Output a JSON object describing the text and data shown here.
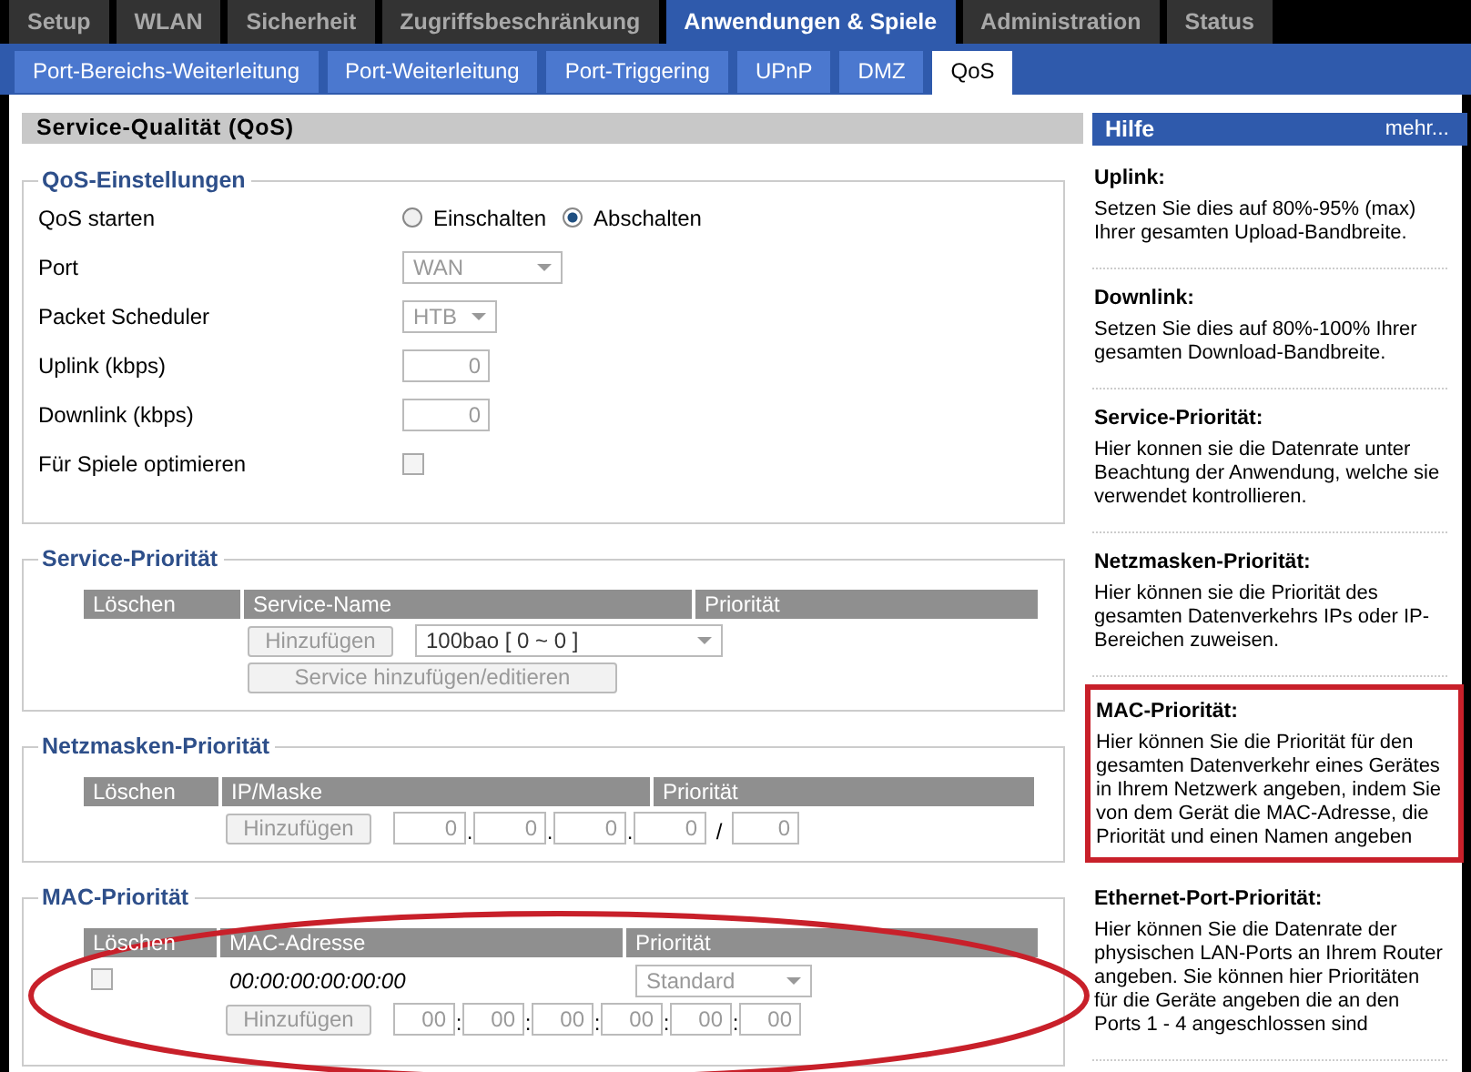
{
  "main_tabs": [
    {
      "label": "Setup",
      "selected": false
    },
    {
      "label": "WLAN",
      "selected": false
    },
    {
      "label": "Sicherheit",
      "selected": false
    },
    {
      "label": "Zugriffsbeschränkung",
      "selected": false
    },
    {
      "label": "Anwendungen & Spiele",
      "selected": true
    },
    {
      "label": "Administration",
      "selected": false
    },
    {
      "label": "Status",
      "selected": false
    }
  ],
  "sub_tabs": [
    {
      "label": "Port-Bereichs-Weiterleitung",
      "selected": false
    },
    {
      "label": "Port-Weiterleitung",
      "selected": false
    },
    {
      "label": "Port-Triggering",
      "selected": false
    },
    {
      "label": "UPnP",
      "selected": false
    },
    {
      "label": "DMZ",
      "selected": false
    },
    {
      "label": "QoS",
      "selected": true
    }
  ],
  "page_title": "Service-Qualität (QoS)",
  "qos_settings": {
    "legend": "QoS-Einstellungen",
    "rows": [
      {
        "kind": "radio",
        "label": "QoS starten",
        "options": [
          {
            "label": "Einschalten",
            "selected": false
          },
          {
            "label": "Abschalten",
            "selected": true
          }
        ]
      },
      {
        "kind": "select",
        "label": "Port",
        "value": "WAN"
      },
      {
        "kind": "select",
        "label": "Packet Scheduler",
        "value": "HTB"
      },
      {
        "kind": "number",
        "label": "Uplink (kbps)",
        "value": "0"
      },
      {
        "kind": "number",
        "label": "Downlink (kbps)",
        "value": "0"
      },
      {
        "kind": "checkbox",
        "label": "Für Spiele optimieren",
        "checked": false
      }
    ]
  },
  "service_priority": {
    "legend": "Service-Priorität",
    "columns": [
      "Löschen",
      "Service-Name",
      "Priorität"
    ],
    "add_button": "Hinzufügen",
    "service_select": "100bao [ 0 ~ 0 ]",
    "edit_button": "Service hinzufügen/editieren"
  },
  "netmask_priority": {
    "legend": "Netzmasken-Priorität",
    "columns": [
      "Löschen",
      "IP/Maske",
      "Priorität"
    ],
    "add_button": "Hinzufügen",
    "ip_fields": [
      "0",
      "0",
      "0",
      "0"
    ],
    "ip_separator": ".",
    "mask_separator": "/",
    "mask_field": "0"
  },
  "mac_priority": {
    "legend": "MAC-Priorität",
    "annotated": true,
    "columns": [
      "Löschen",
      "MAC-Adresse",
      "Priorität"
    ],
    "rows": [
      {
        "checked": false,
        "mac": "00:00:00:00:00:00",
        "priority": "Standard"
      }
    ],
    "add_button": "Hinzufügen",
    "mac_fields": [
      "00",
      "00",
      "00",
      "00",
      "00",
      "00"
    ],
    "mac_separator": ":"
  },
  "help": {
    "title": "Hilfe",
    "more": "mehr...",
    "items": [
      {
        "heading": "Uplink:",
        "text": "Setzen Sie dies auf 80%-95% (max) Ihrer gesamten Upload-Bandbreite.",
        "highlighted": false
      },
      {
        "heading": "Downlink:",
        "text": "Setzen Sie dies auf 80%-100% Ihrer gesamten Download-Bandbreite.",
        "highlighted": false
      },
      {
        "heading": "Service-Priorität:",
        "text": "Hier konnen sie die Datenrate unter Beachtung der Anwendung, welche sie verwendet kontrollieren.",
        "highlighted": false
      },
      {
        "heading": "Netzmasken-Priorität:",
        "text": "Hier können sie die Priorität des gesamten Datenverkehrs IPs oder IP-Bereichen zuweisen.",
        "highlighted": false
      },
      {
        "heading": "MAC-Priorität:",
        "text": "Hier können Sie die Priorität für den gesamten Datenverkehr eines Gerätes in Ihrem Netzwerk angeben, indem Sie von dem Gerät die MAC-Adresse, die Priorität und einen Namen angeben",
        "highlighted": true
      },
      {
        "heading": "Ethernet-Port-Priorität:",
        "text": "Hier können Sie die Datenrate der physischen LAN-Ports an Ihrem Router angeben. Sie können hier Prioritäten für die Geräte angeben die an den Ports 1 - 4 angeschlossen sind",
        "highlighted": false
      }
    ]
  }
}
